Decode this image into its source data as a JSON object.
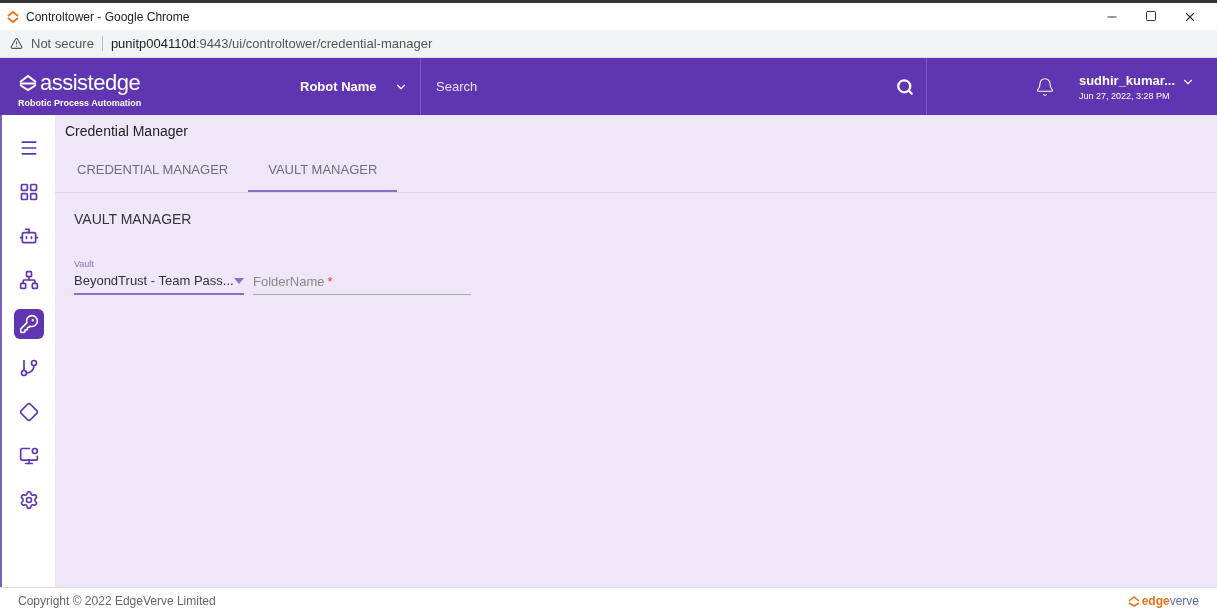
{
  "browser": {
    "title": "Controltower - Google Chrome",
    "security": "Not secure",
    "url_host": "punitp004110d",
    "url_rest": ":9443/ui/controltower/credential-manager"
  },
  "header": {
    "logo": "assist**edge**",
    "tagline": "Robotic Process Automation",
    "robot_select": "Robot Name",
    "search": {
      "placeholder": "Search"
    },
    "user": "sudhir_kumar...",
    "datetime": "Jun 27, 2022, 3:28 PM"
  },
  "sidebar": {
    "items": [
      {
        "selected": false
      },
      {
        "selected": false
      },
      {
        "selected": false
      },
      {
        "selected": false
      },
      {
        "selected": true
      },
      {
        "selected": false
      },
      {
        "selected": false
      },
      {
        "selected": false
      },
      {
        "selected": false
      }
    ]
  },
  "page_title": "Credential Manager",
  "tabs": [
    {
      "label": "CREDENTIAL MANAGER",
      "selected": false
    },
    {
      "label": "VAULT MANAGER",
      "selected": true
    }
  ],
  "section_title": "VAULT MANAGER",
  "vault": {
    "label": "Vault",
    "value": "BeyondTrust - Team Pass..."
  },
  "folder": {
    "placeholder": "FolderName",
    "required": true,
    "required_mark": "*"
  },
  "footer": {
    "copyright": "Copyright © 2022 EdgeVerve Limited",
    "logo": "**edge**verve"
  }
}
